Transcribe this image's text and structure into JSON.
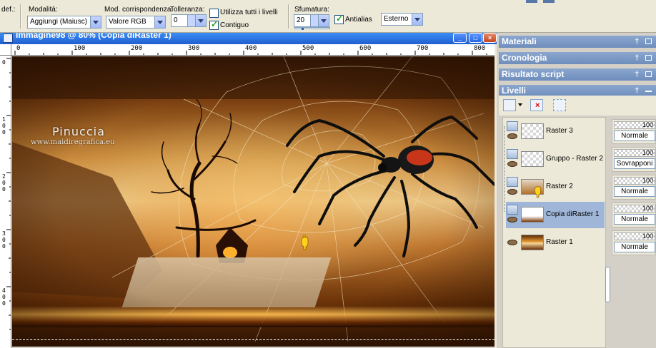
{
  "toolbar": {
    "preset_label": "def.:",
    "mode": {
      "label": "Modalità:",
      "value": "Aggiungi (Maiusc)"
    },
    "match_mode": {
      "label": "Mod. corrispondenza:",
      "value": "Valore RGB"
    },
    "tolerance": {
      "label": "Tolleranza:",
      "value": "0"
    },
    "use_all_layers": {
      "label": "Utilizza tutti i livelli",
      "checked": false
    },
    "contiguous": {
      "label": "Contiguo",
      "checked": true
    },
    "feather": {
      "label": "Sfumatura:",
      "value": "20",
      "slider_fraction": 0.2
    },
    "antialias": {
      "label": "Antialias",
      "checked": true
    },
    "edge_mode": {
      "value": "Esterno"
    }
  },
  "image_window": {
    "title": "Immagine98 @ 80% (Copia diRaster 1)",
    "buttons": {
      "minimize": "_",
      "maximize": "□",
      "close": "×"
    },
    "ruler_h_ticks": [
      "0",
      "100",
      "200",
      "300",
      "400",
      "500",
      "600",
      "700",
      "800"
    ],
    "ruler_v_ticks": [
      "0",
      "100",
      "200",
      "300",
      "400"
    ],
    "watermark": {
      "name": "Pinuccia",
      "url": "www.maidiregrafica.eu"
    }
  },
  "panels": {
    "materials": "Materiali",
    "history": "Cronologia",
    "script_result": "Risultato script",
    "layers": "Livelli"
  },
  "layers": [
    {
      "name": "Raster 3",
      "opacity": "100",
      "blend": "Normale",
      "selected": false
    },
    {
      "name": "Gruppo - Raster 2",
      "opacity": "100",
      "blend": "Sovrapponi",
      "selected": false
    },
    {
      "name": "Raster 2",
      "opacity": "100",
      "blend": "Normale",
      "selected": false
    },
    {
      "name": "Copia diRaster 1",
      "opacity": "100",
      "blend": "Normale",
      "selected": true
    },
    {
      "name": "Raster 1",
      "opacity": "100",
      "blend": "Normale",
      "selected": false
    }
  ],
  "colors": {
    "titlebar": "#1f5fd0",
    "panel_header": "#7792bf",
    "selected_layer": "#9fb6d8"
  }
}
